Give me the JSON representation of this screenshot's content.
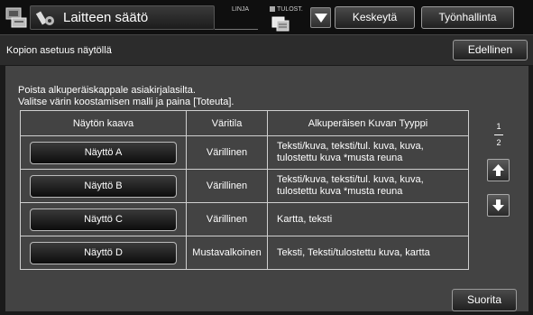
{
  "header": {
    "title": "Laitteen säätö",
    "app_icon": "copier-settings-icon",
    "title_icon": "settings-wrench-icon",
    "linja_label": "LINJA",
    "tulost_label": "TULOST.",
    "tulost_icon": "print-job-icon",
    "dropdown_icon": "triangle-down-icon",
    "keskeyta_label": "Keskeytä",
    "tyonhallinta_label": "Työnhallinta"
  },
  "subheader": {
    "title": "Kopion asetuus näytöllä",
    "back_label": "Edellinen"
  },
  "instructions": {
    "line1": "Poista alkuperäiskappale asiakirjalasilta.",
    "line2": "Valitse värin koostamisen malli ja paina [Toteuta]."
  },
  "table": {
    "headers": [
      "Näytön kaava",
      "Väritila",
      "Alkuperäisen Kuvan Tyyppi"
    ],
    "rows": [
      {
        "mode": "Näyttö A",
        "color": "Värillinen",
        "type_line1": "Teksti/kuva, teksti/tul. kuva, kuva,",
        "type_line2": "tulostettu kuva *musta reuna"
      },
      {
        "mode": "Näyttö B",
        "color": "Värillinen",
        "type_line1": "Teksti/kuva, teksti/tul. kuva, kuva,",
        "type_line2": "tulostettu kuva *musta reuna"
      },
      {
        "mode": "Näyttö C",
        "color": "Värillinen",
        "type_line1": "Kartta, teksti",
        "type_line2": ""
      },
      {
        "mode": "Näyttö D",
        "color": "Mustavalkoinen",
        "type_line1": "Teksti, Teksti/tulostettu kuva, kartta",
        "type_line2": ""
      }
    ]
  },
  "pager": {
    "current": "1",
    "total": "2",
    "up_icon": "arrow-up-icon",
    "down_icon": "arrow-down-icon"
  },
  "footer": {
    "execute_label": "Suorita"
  }
}
